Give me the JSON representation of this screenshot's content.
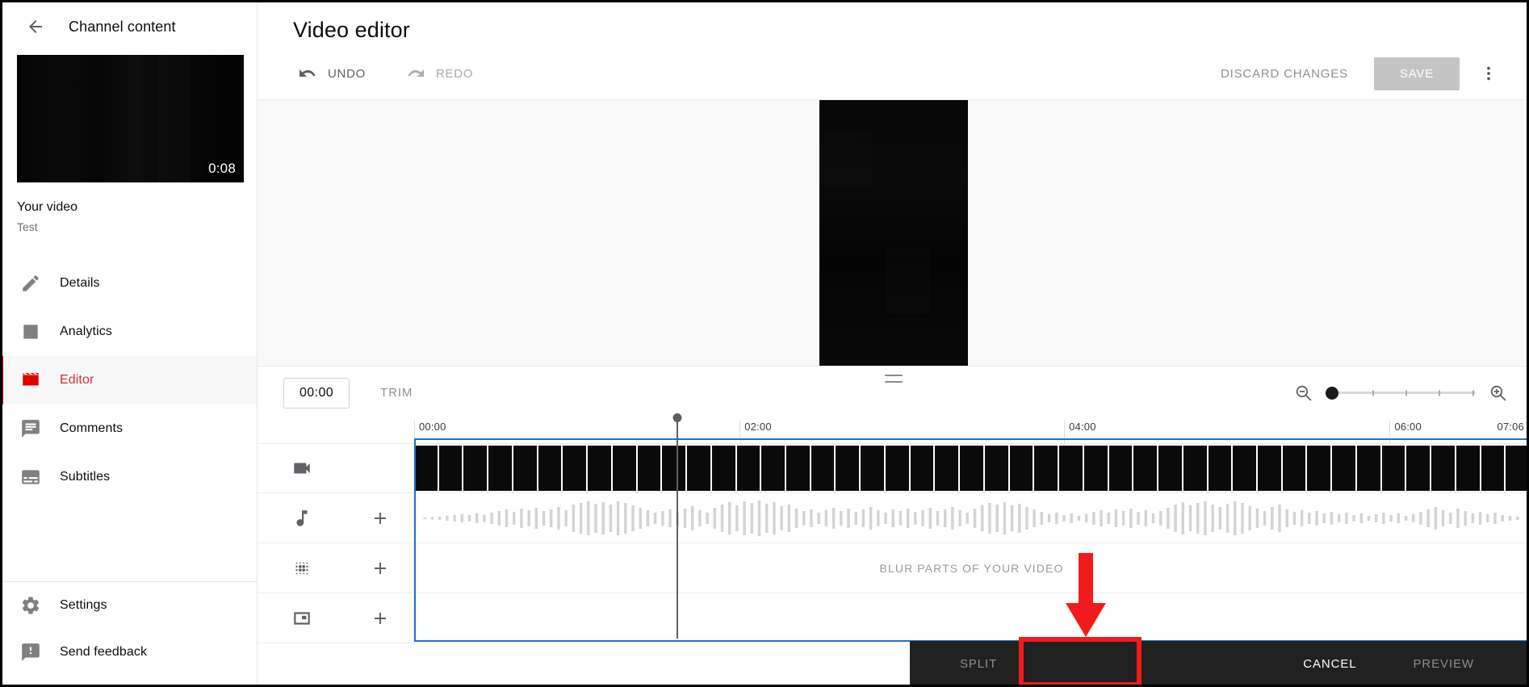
{
  "sidebar": {
    "back_icon": "arrow-left-icon",
    "title": "Channel content",
    "thumbnail": {
      "duration": "0:08"
    },
    "video_title": "Your video",
    "video_subtitle": "Test",
    "items": [
      {
        "label": "Details",
        "icon": "pencil-icon",
        "active": false
      },
      {
        "label": "Analytics",
        "icon": "bar-chart-icon",
        "active": false
      },
      {
        "label": "Editor",
        "icon": "clapboard-icon",
        "active": true
      },
      {
        "label": "Comments",
        "icon": "comment-icon",
        "active": false
      },
      {
        "label": "Subtitles",
        "icon": "subtitles-icon",
        "active": false
      }
    ],
    "bottom_items": [
      {
        "label": "Settings",
        "icon": "gear-icon"
      },
      {
        "label": "Send feedback",
        "icon": "feedback-icon"
      }
    ]
  },
  "header": {
    "page_title": "Video editor",
    "undo_label": "UNDO",
    "redo_label": "REDO",
    "discard_label": "DISCARD CHANGES",
    "save_label": "SAVE",
    "kebab_icon": "more-vertical-icon"
  },
  "timeline_controls": {
    "timecode": "00:00",
    "trim_label": "TRIM",
    "zoom_out_icon": "zoom-out-icon",
    "zoom_in_icon": "zoom-in-icon",
    "zoom_value": 0,
    "zoom_ticks": [
      25,
      50,
      75,
      100
    ]
  },
  "timeline": {
    "ruler_labels": [
      "00:00",
      "02:00",
      "04:00",
      "06:00",
      "07:06"
    ],
    "ruler_positions": [
      0,
      29.2,
      58.3,
      87.5,
      100
    ],
    "playhead_time": "00:00",
    "tracks": [
      {
        "name": "video",
        "icon": "video-camera-icon",
        "add": false,
        "content": "filmstrip"
      },
      {
        "name": "audio",
        "icon": "music-note-icon",
        "add": true,
        "content": "waveform"
      },
      {
        "name": "blur",
        "icon": "blur-grid-icon",
        "add": true,
        "content": "label",
        "label": "BLUR PARTS OF YOUR VIDEO"
      },
      {
        "name": "end-screen",
        "icon": "end-screen-icon",
        "add": true,
        "content": "empty"
      }
    ]
  },
  "bottom_bar": {
    "split_label": "SPLIT",
    "cancel_label": "CANCEL",
    "preview_label": "PREVIEW"
  },
  "annotations": {
    "highlight_color": "#f21b1b",
    "arrow_icon": "down-arrow-annotation",
    "highlight_target": "PREVIEW"
  }
}
